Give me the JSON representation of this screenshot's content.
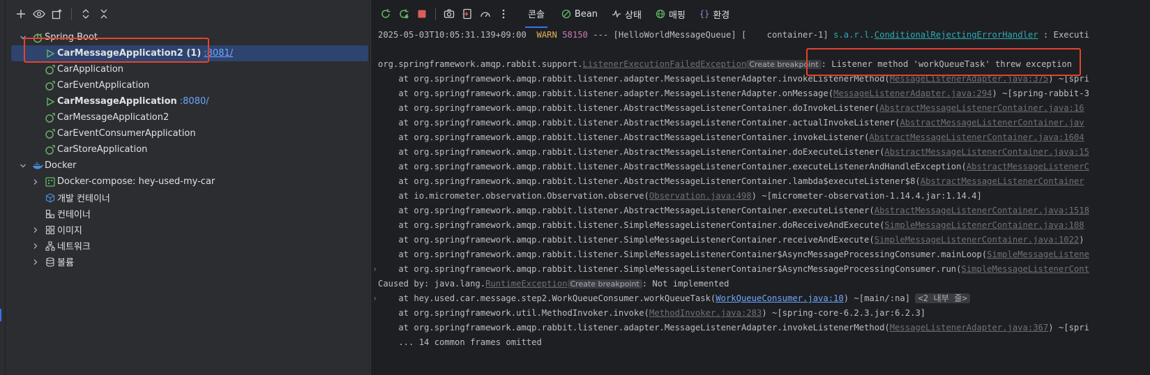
{
  "left_toolbar": {
    "icons": [
      "plus-icon",
      "eye-icon",
      "new-tab-icon",
      "expand-all-icon",
      "collapse-all-icon"
    ]
  },
  "tree": {
    "spring_boot": {
      "label": "Spring Boot",
      "children": [
        {
          "label": "CarMessageApplication2 (1)",
          "port": ":8081/",
          "running": true,
          "selected": true
        },
        {
          "label": "CarApplication",
          "port": "",
          "running": false
        },
        {
          "label": "CarEventApplication",
          "port": "",
          "running": false
        },
        {
          "label": "CarMessageApplication",
          "port": ":8080/",
          "running": true
        },
        {
          "label": "CarMessageApplication2",
          "port": "",
          "running": false
        },
        {
          "label": "CarEventConsumerApplication",
          "port": "",
          "running": false
        },
        {
          "label": "CarStoreApplication",
          "port": "",
          "running": false
        }
      ]
    },
    "docker": {
      "label": "Docker",
      "children": [
        {
          "label": "Docker-compose: hey-used-my-car"
        },
        {
          "label": "개발 컨테이너"
        },
        {
          "label": "컨테이너"
        },
        {
          "label": "이미지"
        },
        {
          "label": "네트워크"
        },
        {
          "label": "볼륨"
        }
      ]
    }
  },
  "tabs": {
    "console": "콘솔",
    "bean": "Bean",
    "state": "상태",
    "mapping": "매핑",
    "env": "환경"
  },
  "colors": {
    "accent": "#3574f0",
    "highlight_box": "#e5432d",
    "warn": "#e0b45a",
    "link": "#6fa8ff"
  },
  "console": {
    "l1_ts": "2025-05-03T10:05:31.139+09:00",
    "l1_level": "WARN",
    "l1_pid": "58150",
    "l1_mid": " --- [HelloWorldMessageQueue] [    container-1] ",
    "l1_cls": "s.a.r.l.",
    "l1_cls_link": "ConditionalRejectingErrorHandler",
    "l1_tail": " : Executi",
    "l3_pre": "org.springframework.amqp.rabbit.support.",
    "l3_link": "ListenerExecutionFailedException",
    "bp": "Create breakpoint",
    "l3_msg": ": Listener method 'workQueueTask' threw exception",
    "l4_pre": "    at org.springframework.amqp.rabbit.listener.adapter.MessageListenerAdapter.invokeListenerMethod(",
    "l4_link": "MessageListenerAdapter.java:375",
    "l4_post": ") ~[spri",
    "l5_pre": "    at org.springframework.amqp.rabbit.listener.adapter.MessageListenerAdapter.onMessage(",
    "l5_link": "MessageListenerAdapter.java:294",
    "l5_post": ") ~[spring-rabbit-3",
    "l6_pre": "    at org.springframework.amqp.rabbit.listener.AbstractMessageListenerContainer.doInvokeListener(",
    "l6_link": "AbstractMessageListenerContainer.java:16",
    "l7_pre": "    at org.springframework.amqp.rabbit.listener.AbstractMessageListenerContainer.actualInvokeListener(",
    "l7_link": "AbstractMessageListenerContainer.jav",
    "l8_pre": "    at org.springframework.amqp.rabbit.listener.AbstractMessageListenerContainer.invokeListener(",
    "l8_link": "AbstractMessageListenerContainer.java:1604",
    "l9_pre": "    at org.springframework.amqp.rabbit.listener.AbstractMessageListenerContainer.doExecuteListener(",
    "l9_link": "AbstractMessageListenerContainer.java:15",
    "l10_pre": "    at org.springframework.amqp.rabbit.listener.AbstractMessageListenerContainer.executeListenerAndHandleException(",
    "l10_link": "AbstractMessageListenerC",
    "l11_pre": "    at org.springframework.amqp.rabbit.listener.AbstractMessageListenerContainer.lambda$executeListener$8(",
    "l11_link": "AbstractMessageListenerContainer",
    "l12_pre": "    at io.micrometer.observation.Observation.observe(",
    "l12_link": "Observation.java:498",
    "l12_post": ") ~[micrometer-observation-1.14.4.jar:1.14.4]",
    "l13_pre": "    at org.springframework.amqp.rabbit.listener.AbstractMessageListenerContainer.executeListener(",
    "l13_link": "AbstractMessageListenerContainer.java:1518",
    "l14_pre": "    at org.springframework.amqp.rabbit.listener.SimpleMessageListenerContainer.doReceiveAndExecute(",
    "l14_link": "SimpleMessageListenerContainer.java:108",
    "l15_pre": "    at org.springframework.amqp.rabbit.listener.SimpleMessageListenerContainer.receiveAndExecute(",
    "l15_link": "SimpleMessageListenerContainer.java:1022",
    "l15_post": ")",
    "l16_pre": "    at org.springframework.amqp.rabbit.listener.SimpleMessageListenerContainer$AsyncMessageProcessingConsumer.mainLoop(",
    "l16_link": "SimpleMessageListene",
    "l17_pre": "    at org.springframework.amqp.rabbit.listener.SimpleMessageListenerContainer$AsyncMessageProcessingConsumer.run(",
    "l17_link": "SimpleMessageListenerCont",
    "l18_pre": "Caused by: java.lang.",
    "l18_link": "RuntimeException",
    "l18_msg": ": Not implemented",
    "l19_pre": "    at hey.used.car.message.step2.WorkQueueConsumer.workQueueTask(",
    "l19_link": "WorkQueueConsumer.java:10",
    "l19_post": ") ~[main/:na]",
    "l19_fold": "<2 내부 줄>",
    "l20_pre": "    at org.springframework.util.MethodInvoker.invoke(",
    "l20_link": "MethodInvoker.java:283",
    "l20_post": ") ~[spring-core-6.2.3.jar:6.2.3]",
    "l21_pre": "    at org.springframework.amqp.rabbit.listener.adapter.MessageListenerAdapter.invokeListenerMethod(",
    "l21_link": "MessageListenerAdapter.java:367",
    "l21_post": ") ~[spri",
    "l22": "    ... 14 common frames omitted"
  }
}
